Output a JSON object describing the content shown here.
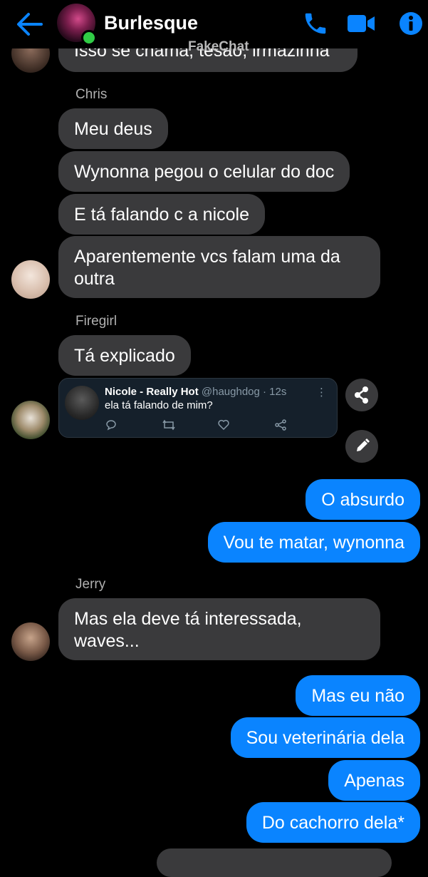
{
  "header": {
    "title": "Burlesque",
    "watermark": "FakeChat"
  },
  "messages": {
    "partial_top": "Isso se chama, tesão, irmãzinha",
    "chris": {
      "name": "Chris",
      "lines": [
        "Meu deus",
        "Wynonna pegou o celular do doc",
        "E tá falando c a nicole",
        "Aparentemente vcs falam uma da outra"
      ]
    },
    "firegirl": {
      "name": "Firegirl",
      "text": "Tá explicado",
      "tweet": {
        "name": "Nicole - Really Hot",
        "handle": "@haughdog · 12s",
        "text": "ela tá falando de mim?"
      }
    },
    "me_1": [
      "O absurdo",
      "Vou te matar, wynonna"
    ],
    "jerry": {
      "name": "Jerry",
      "text": "Mas ela deve tá interessada, waves..."
    },
    "me_2": [
      "Mas eu não",
      "Sou veterinária dela",
      "Apenas",
      "Do cachorro dela*"
    ]
  },
  "colors": {
    "accent": "#0a84ff",
    "incoming_bubble": "#3a3a3c",
    "background": "#000000",
    "online": "#31cc46"
  },
  "icons": [
    "back-arrow-icon",
    "phone-icon",
    "video-icon",
    "info-icon",
    "share-icon",
    "edit-icon",
    "reply-icon",
    "retweet-icon",
    "heart-icon",
    "tweet-share-icon",
    "more-icon"
  ]
}
